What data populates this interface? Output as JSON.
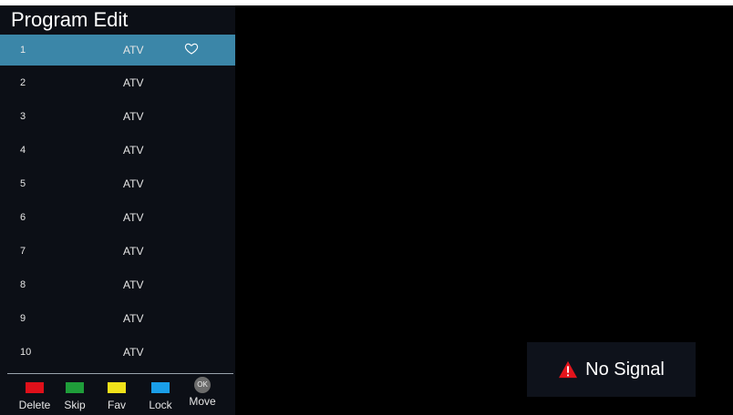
{
  "panel": {
    "title": "Program Edit",
    "channels": [
      {
        "number": "1",
        "type": "ATV",
        "favorite": true,
        "selected": true
      },
      {
        "number": "2",
        "type": "ATV"
      },
      {
        "number": "3",
        "type": "ATV"
      },
      {
        "number": "4",
        "type": "ATV"
      },
      {
        "number": "5",
        "type": "ATV"
      },
      {
        "number": "6",
        "type": "ATV"
      },
      {
        "number": "7",
        "type": "ATV"
      },
      {
        "number": "8",
        "type": "ATV"
      },
      {
        "number": "9",
        "type": "ATV"
      },
      {
        "number": "10",
        "type": "ATV"
      }
    ]
  },
  "legend": {
    "delete": {
      "label": "Delete",
      "color": "#e0101a"
    },
    "skip": {
      "label": "Skip",
      "color": "#1f9d3a"
    },
    "fav": {
      "label": "Fav",
      "color": "#f1e21a"
    },
    "lock": {
      "label": "Lock",
      "color": "#1a9ee8"
    },
    "move": {
      "label": "Move",
      "chip": "OK"
    }
  },
  "status": {
    "no_signal": "No Signal",
    "warning_color": "#e3141c"
  },
  "colors": {
    "panel_bg": "#0c0f16",
    "selected_row": "#3b86a8"
  }
}
